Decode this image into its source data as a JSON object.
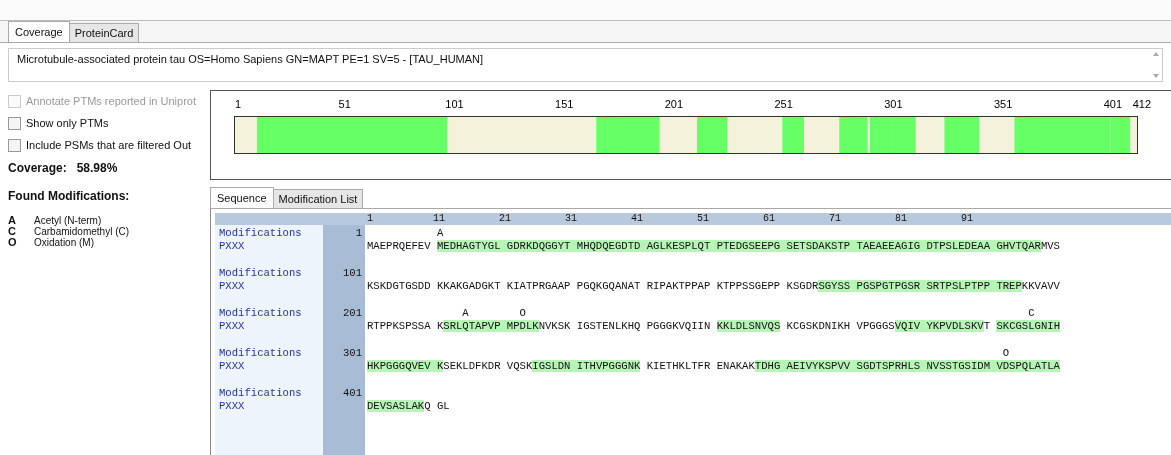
{
  "tabs": [
    {
      "label": "Coverage",
      "selected": true
    },
    {
      "label": "ProteinCard",
      "selected": false
    }
  ],
  "description": "Microtubule-associated protein tau OS=Homo Sapiens GN=MAPT PE=1 SV=5 - [TAU_HUMAN]",
  "options": [
    {
      "label": "Annotate PTMs reported in Uniprot",
      "checked": false,
      "disabled": true
    },
    {
      "label": "Show only PTMs",
      "checked": false,
      "disabled": false
    },
    {
      "label": "Include PSMs that are filtered Out",
      "checked": false,
      "disabled": false
    }
  ],
  "coverage": {
    "label": "Coverage:",
    "value": "58.98%"
  },
  "found_modifications": {
    "title": "Found Modifications:",
    "items": [
      {
        "code": "A",
        "name": "Acetyl (N-term)"
      },
      {
        "code": "C",
        "name": "Carbamidomethyl (C)"
      },
      {
        "code": "O",
        "name": "Oxidation (M)"
      }
    ]
  },
  "coverage_map": {
    "ticks": [
      "1",
      "51",
      "101",
      "151",
      "201",
      "251",
      "301",
      "351",
      "401",
      "412"
    ]
  },
  "sequence_tabs": [
    {
      "label": "Sequence",
      "selected": true
    },
    {
      "label": "Modification List",
      "selected": false
    }
  ],
  "ruler": [
    "1",
    "11",
    "21",
    "31",
    "41",
    "51",
    "61",
    "71",
    "81",
    "91"
  ],
  "rows": [
    {
      "mod_label": "Modifications",
      "track_label": "PXXX",
      "start": "1",
      "mods": [
        "           A"
      ],
      "segments": [
        {
          "text": "MAEPRQEFEV ",
          "covered": false
        },
        {
          "text": "MEDHAGTYGL GDRKDQGGYT MHQDQEGDTD AGLKESPLQT PTEDGSEEPG SETSDAKSTP TAEAEEAGIG DTPSLEDEAA GHVTQAR",
          "covered": true
        },
        {
          "text": "MVS",
          "covered": false
        }
      ]
    },
    {
      "mod_label": "Modifications",
      "track_label": "PXXX",
      "start": "101",
      "mods": [],
      "segments": [
        {
          "text": "KSKDGTGSDD KKAKGADGKT KIATPRGAAP PGQKGQANAT RIPAKTPPAP KTPPSSGEPP KSGDR",
          "covered": false
        },
        {
          "text": "SGYSS PGSPGTPGSR SRTPSLPTPP TREP",
          "covered": true
        },
        {
          "text": "KKVAVV",
          "covered": false
        }
      ]
    },
    {
      "mod_label": "Modifications",
      "track_label": "PXXX",
      "start": "201",
      "mods": [
        "               A",
        "        O",
        "                                                                               C"
      ],
      "segments": [
        {
          "text": "RTPPKSPSSA K",
          "covered": false
        },
        {
          "text": "SRLQTAPVP MPDLK",
          "covered": true
        },
        {
          "text": "NVKSK IGSTENLKHQ PGGGKVQIIN ",
          "covered": false
        },
        {
          "text": "KKLDLSNVQS",
          "covered": true
        },
        {
          "text": " KCGSKDNIKH VPGGGS",
          "covered": false
        },
        {
          "text": "VQIV YKPVDLSKV",
          "covered": true
        },
        {
          "text": "T ",
          "covered": false
        },
        {
          "text": "SKCGSLGNIH",
          "covered": true
        }
      ]
    },
    {
      "mod_label": "Modifications",
      "track_label": "PXXX",
      "start": "301",
      "mods": [
        "                                                                                                    O"
      ],
      "segments": [
        {
          "text": "HKPGGGQVEV K",
          "covered": true
        },
        {
          "text": "SEKLDFKDR VQSK",
          "covered": false
        },
        {
          "text": "IGSLDN ITHVPGGGNK",
          "covered": true
        },
        {
          "text": " KIETHKLTFR ENAKAK",
          "covered": false
        },
        {
          "text": "TDHG AEIVYKSPVV SGDTSPRHLS NVSSTGSIDM VDSPQLATLA",
          "covered": true
        }
      ]
    },
    {
      "mod_label": "Modifications",
      "track_label": "PXXX",
      "start": "401",
      "mods": [],
      "segments": [
        {
          "text": "DEVSASLAK",
          "covered": true
        },
        {
          "text": "Q GL",
          "covered": false
        }
      ]
    }
  ]
}
